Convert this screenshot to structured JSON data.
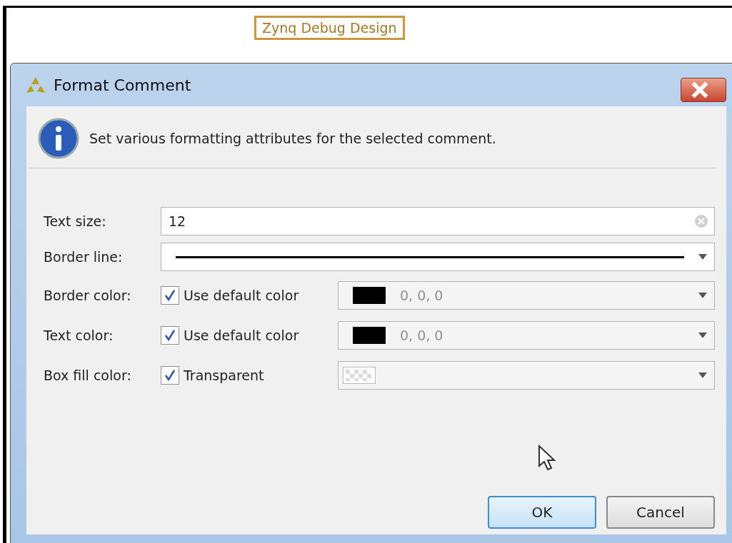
{
  "canvas": {
    "comment": "Zynq Debug Design"
  },
  "dialog": {
    "title": "Format Comment",
    "message": "Set various formatting attributes for the selected comment."
  },
  "fields": [
    {
      "kind": "text",
      "label": "Text size:",
      "value": "12"
    },
    {
      "kind": "line",
      "label": "Border line:"
    },
    {
      "kind": "color",
      "label": "Border color:",
      "checkbox": {
        "label": "Use default color",
        "checked": true
      },
      "color": "#000000",
      "reading": "0, 0, 0"
    },
    {
      "kind": "color",
      "label": "Text color:",
      "checkbox": {
        "label": "Use default color",
        "checked": true
      },
      "color": "#000000",
      "reading": "0, 0, 0"
    },
    {
      "kind": "fill",
      "label": "Box fill color:",
      "checkbox": {
        "label": "Transparent",
        "checked": true
      }
    }
  ],
  "buttons": [
    {
      "label": "OK",
      "default": true
    },
    {
      "label": "Cancel",
      "default": false
    }
  ]
}
